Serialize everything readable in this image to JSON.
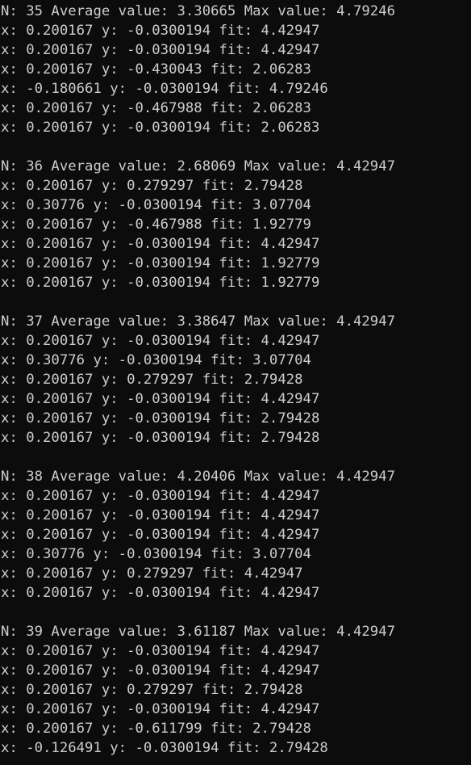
{
  "console": {
    "lines": [
      "N: 35 Average value: 3.30665 Max value: 4.79246",
      "x: 0.200167 y: -0.0300194 fit: 4.42947",
      "x: 0.200167 y: -0.0300194 fit: 4.42947",
      "x: 0.200167 y: -0.430043 fit: 2.06283",
      "x: -0.180661 y: -0.0300194 fit: 4.79246",
      "x: 0.200167 y: -0.467988 fit: 2.06283",
      "x: 0.200167 y: -0.0300194 fit: 2.06283",
      "",
      "N: 36 Average value: 2.68069 Max value: 4.42947",
      "x: 0.200167 y: 0.279297 fit: 2.79428",
      "x: 0.30776 y: -0.0300194 fit: 3.07704",
      "x: 0.200167 y: -0.467988 fit: 1.92779",
      "x: 0.200167 y: -0.0300194 fit: 4.42947",
      "x: 0.200167 y: -0.0300194 fit: 1.92779",
      "x: 0.200167 y: -0.0300194 fit: 1.92779",
      "",
      "N: 37 Average value: 3.38647 Max value: 4.42947",
      "x: 0.200167 y: -0.0300194 fit: 4.42947",
      "x: 0.30776 y: -0.0300194 fit: 3.07704",
      "x: 0.200167 y: 0.279297 fit: 2.79428",
      "x: 0.200167 y: -0.0300194 fit: 4.42947",
      "x: 0.200167 y: -0.0300194 fit: 2.79428",
      "x: 0.200167 y: -0.0300194 fit: 2.79428",
      "",
      "N: 38 Average value: 4.20406 Max value: 4.42947",
      "x: 0.200167 y: -0.0300194 fit: 4.42947",
      "x: 0.200167 y: -0.0300194 fit: 4.42947",
      "x: 0.200167 y: -0.0300194 fit: 4.42947",
      "x: 0.30776 y: -0.0300194 fit: 3.07704",
      "x: 0.200167 y: 0.279297 fit: 4.42947",
      "x: 0.200167 y: -0.0300194 fit: 4.42947",
      "",
      "N: 39 Average value: 3.61187 Max value: 4.42947",
      "x: 0.200167 y: -0.0300194 fit: 4.42947",
      "x: 0.200167 y: -0.0300194 fit: 4.42947",
      "x: 0.200167 y: 0.279297 fit: 2.79428",
      "x: 0.200167 y: -0.0300194 fit: 4.42947",
      "x: 0.200167 y: -0.611799 fit: 2.79428",
      "x: -0.126491 y: -0.0300194 fit: 2.79428"
    ]
  },
  "colors": {
    "background": "#0c0c0c",
    "text": "#cccccc"
  }
}
